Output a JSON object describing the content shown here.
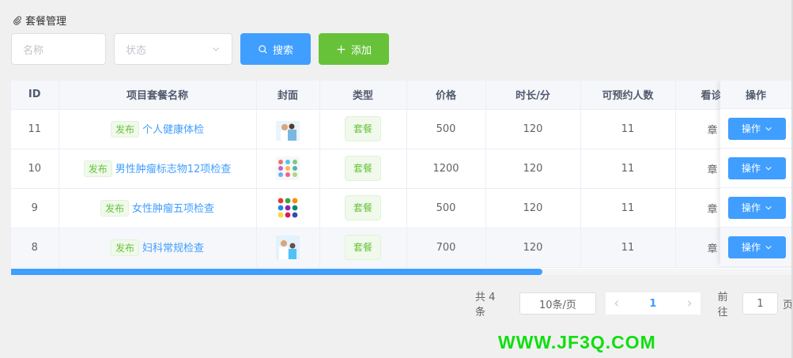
{
  "header": {
    "title": "套餐管理"
  },
  "search": {
    "name_placeholder": "名称",
    "status_placeholder": "状态",
    "search_label": "搜索",
    "add_label": "添加"
  },
  "table": {
    "columns": [
      "ID",
      "项目套餐名称",
      "封面",
      "类型",
      "价格",
      "时长/分",
      "可预约人数",
      "看诊",
      "操作"
    ],
    "rows": [
      {
        "id": "11",
        "status": "发布",
        "name": "个人健康体检",
        "type": "套餐",
        "price": "500",
        "duration": "120",
        "capacity": "11",
        "doctor": "章",
        "op": "操作"
      },
      {
        "id": "10",
        "status": "发布",
        "name": "男性肿瘤标志物12项检查",
        "type": "套餐",
        "price": "1200",
        "duration": "120",
        "capacity": "11",
        "doctor": "章",
        "op": "操作"
      },
      {
        "id": "9",
        "status": "发布",
        "name": "女性肿瘤五项检查",
        "type": "套餐",
        "price": "500",
        "duration": "120",
        "capacity": "11",
        "doctor": "章",
        "op": "操作"
      },
      {
        "id": "8",
        "status": "发布",
        "name": "妇科常规检查",
        "type": "套餐",
        "price": "700",
        "duration": "120",
        "capacity": "11",
        "doctor": "章",
        "op": "操作"
      }
    ]
  },
  "pagination": {
    "total": "共 4 条",
    "page_size": "10条/页",
    "current": "1",
    "goto_label": "前往",
    "goto_value": "1",
    "page_unit": "页"
  },
  "watermark": "WWW.JF3Q.COM"
}
